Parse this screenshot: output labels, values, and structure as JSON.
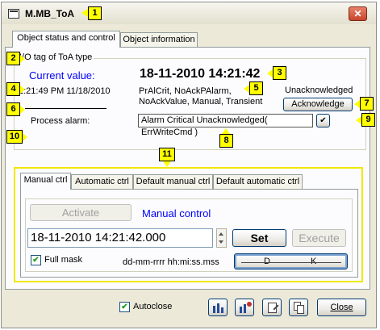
{
  "window": {
    "title": "M.MB_ToA",
    "close_glyph": "✕"
  },
  "tabs": [
    {
      "label": "Object status and control",
      "active": true
    },
    {
      "label": "Object information",
      "active": false
    }
  ],
  "status": {
    "io_tag": "I/O tag of ToA type",
    "current_value_label": "Current value:",
    "current_value": "18-11-2010 14:21:42",
    "timestamp": "2:21:49 PM 11/18/2010",
    "flags_line1": "PrAlCrit, NoAckPAlarm,",
    "flags_line2": "NoAckValue, Manual, Transient",
    "ack_state": "Unacknowledged",
    "ack_button": "Acknowledge",
    "process_alarm_label": "Process alarm:",
    "process_alarm_value": "Alarm Critical Unacknowledged( ErrWriteCmd )",
    "check_glyph": "✔"
  },
  "control": {
    "tabs": [
      {
        "label": "Manual ctrl",
        "active": true
      },
      {
        "label": "Automatic ctrl",
        "active": false
      },
      {
        "label": "Default manual ctrl",
        "active": false
      },
      {
        "label": "Default automatic ctrl",
        "active": false
      }
    ],
    "activate_button": "Activate",
    "mode_label": "Manual control",
    "value_input": "18-11-2010 14:21:42.000",
    "set_button": "Set",
    "execute_button": "Execute",
    "full_mask_label": "Full mask",
    "full_mask_checked": true,
    "format_hint": "dd-mm-rrrr hh:mi:ss.mss",
    "dk_left": "D",
    "dk_right": "K"
  },
  "footer": {
    "autoclose_label": "Autoclose",
    "autoclose_checked": true,
    "close_button": "Close"
  },
  "badges": [
    "1",
    "2",
    "3",
    "4",
    "5",
    "6",
    "7",
    "8",
    "9",
    "10",
    "11"
  ],
  "colors": {
    "accent_blue": "#0000ff",
    "highlight_yellow": "#ffff00"
  }
}
